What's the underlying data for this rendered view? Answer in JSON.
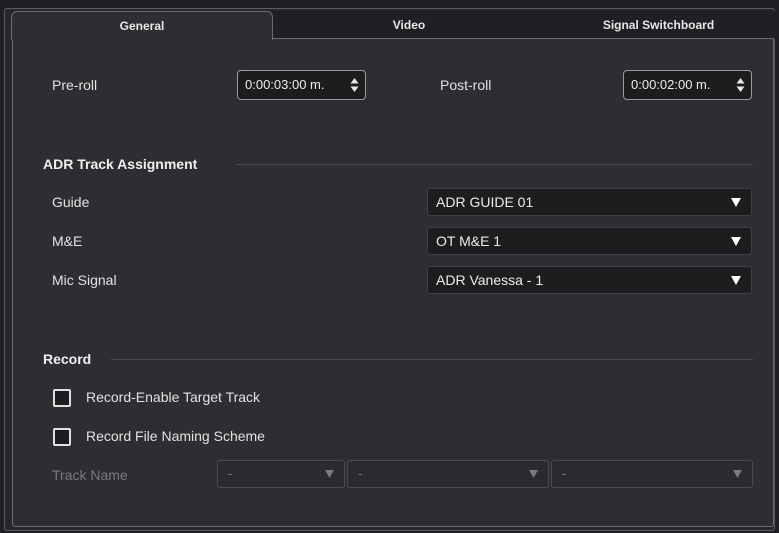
{
  "tabs": [
    {
      "label": "General",
      "active": true
    },
    {
      "label": "Video",
      "active": false
    },
    {
      "label": "Signal Switchboard",
      "active": false
    }
  ],
  "general": {
    "preroll_label": "Pre-roll",
    "preroll_value": "0:00:03:00 m.",
    "postroll_label": "Post-roll",
    "postroll_value": "0:00:02:00 m."
  },
  "adr": {
    "title": "ADR Track Assignment",
    "guide_label": "Guide",
    "guide_value": "ADR GUIDE 01",
    "me_label": "M&E",
    "me_value": "OT M&E 1",
    "mic_label": "Mic Signal",
    "mic_value": "ADR Vanessa - 1"
  },
  "record": {
    "title": "Record",
    "enable_target_label": "Record-Enable Target Track",
    "enable_target_checked": false,
    "naming_label": "Record File Naming Scheme",
    "naming_checked": false,
    "track_name_label": "Track Name",
    "naming_fields": [
      "-",
      "-",
      "-"
    ]
  },
  "icons": {
    "spinner": "up-down-arrows-icon",
    "dropdown": "triangle-down-icon"
  },
  "colors": {
    "background": "#1f2023",
    "panel": "#2d2e31",
    "field": "#1c1d1f",
    "text": "#e2e2e2",
    "disabled_text": "#7a7b7e"
  }
}
